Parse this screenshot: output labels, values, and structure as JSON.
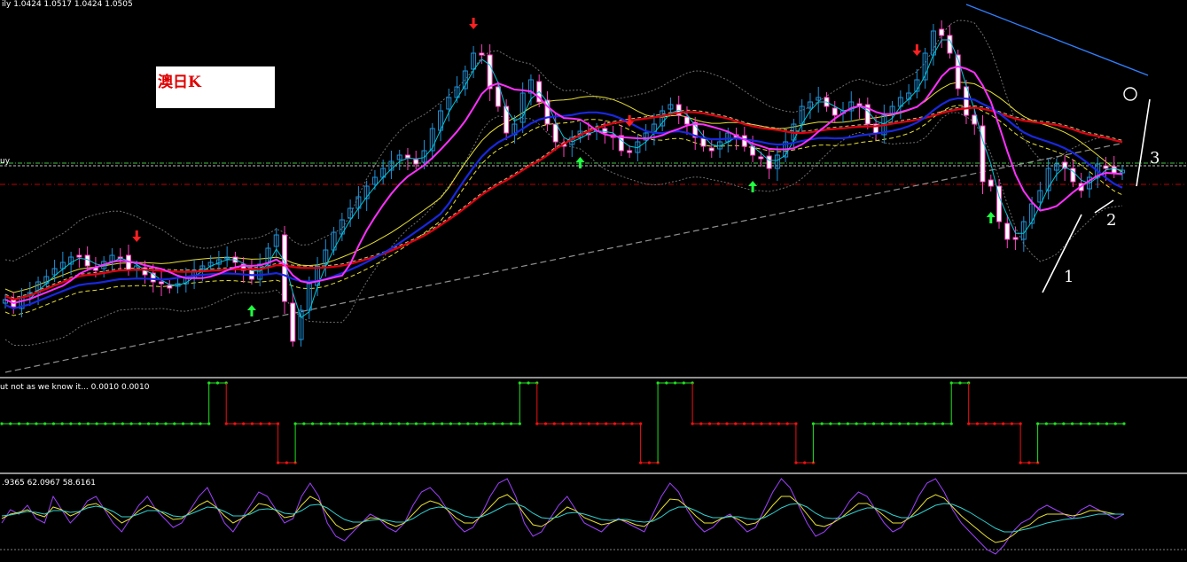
{
  "header": {
    "main_ohlc": "ily  1.0424 1.0517 1.0424 1.0505",
    "left_cut_label": "uy",
    "indicator1": "ut not as we know it...  0.0010 0.0010",
    "indicator2": ".9365 62.0967 58.6161"
  },
  "annotation": {
    "title": "澳日K",
    "wave_labels": [
      "1",
      "2",
      "3"
    ]
  },
  "colors": {
    "up_candle": "#1e90d8",
    "down_candle": "#ffffff",
    "down_candle_edge": "#ff40c0",
    "ma_fast": "#00c8d8",
    "ma_magenta": "#ff30ff",
    "ma_blue": "#1828e0",
    "ma_red": "#e00010",
    "band_yellow": "#e8e030",
    "long_ma": "#909090",
    "arrow_up": "#20ff40",
    "arrow_down": "#ff2020",
    "trend_line": "#3080ff",
    "level_green": "#40c040",
    "level_red": "#c00000"
  },
  "chart_data": [
    {
      "type": "candlestick",
      "title": "澳日K",
      "header": "ily  1.0424 1.0517 1.0424 1.0505",
      "close_path": [
        338,
        346,
        335,
        330,
        318,
        312,
        303,
        296,
        290,
        288,
        300,
        305,
        295,
        288,
        290,
        305,
        300,
        310,
        318,
        320,
        325,
        320,
        312,
        305,
        300,
        296,
        293,
        290,
        296,
        305,
        315,
        298,
        280,
        265,
        340,
        385,
        350,
        320,
        300,
        282,
        262,
        248,
        235,
        222,
        210,
        200,
        190,
        182,
        175,
        178,
        185,
        170,
        145,
        125,
        110,
        98,
        80,
        60,
        60,
        100,
        120,
        150,
        140,
        105,
        90,
        115,
        140,
        160,
        165,
        155,
        148,
        150,
        145,
        150,
        155,
        170,
        170,
        160,
        150,
        140,
        125,
        118,
        130,
        140,
        155,
        165,
        170,
        160,
        150,
        155,
        165,
        175,
        178,
        190,
        175,
        160,
        140,
        120,
        115,
        110,
        120,
        130,
        125,
        115,
        120,
        140,
        150,
        130,
        120,
        110,
        105,
        90,
        60,
        35,
        40,
        60,
        100,
        130,
        140,
        205,
        210,
        250,
        270,
        270,
        250,
        230,
        215,
        190,
        185,
        190,
        205,
        215,
        200,
        185,
        190,
        195,
        192
      ],
      "signal_arrows": [
        {
          "dir": "down",
          "bar": 16
        },
        {
          "dir": "up",
          "bar": 30
        },
        {
          "dir": "down",
          "bar": 57
        },
        {
          "dir": "up",
          "bar": 70
        },
        {
          "dir": "down",
          "bar": 76
        },
        {
          "dir": "up",
          "bar": 91
        },
        {
          "dir": "down",
          "bar": 111
        },
        {
          "dir": "up",
          "bar": 120
        }
      ]
    },
    {
      "type": "line",
      "header": "ut not as we know it...  0.0010 0.0010",
      "segments": [
        {
          "color": "green",
          "level": "mid",
          "from": 0,
          "to": 24
        },
        {
          "color": "green",
          "level": "peak",
          "from": 24,
          "to": 26
        },
        {
          "color": "red",
          "level": "mid",
          "from": 26,
          "to": 32
        },
        {
          "color": "red",
          "level": "trough",
          "from": 32,
          "to": 34
        },
        {
          "color": "green",
          "level": "mid",
          "from": 34,
          "to": 60
        },
        {
          "color": "green",
          "level": "peak",
          "from": 60,
          "to": 62
        },
        {
          "color": "red",
          "level": "mid",
          "from": 62,
          "to": 74
        },
        {
          "color": "red",
          "level": "trough",
          "from": 74,
          "to": 76
        },
        {
          "color": "green",
          "level": "peak",
          "from": 76,
          "to": 80
        },
        {
          "color": "red",
          "level": "mid",
          "from": 80,
          "to": 92
        },
        {
          "color": "red",
          "level": "trough",
          "from": 92,
          "to": 94
        },
        {
          "color": "green",
          "level": "mid",
          "from": 94,
          "to": 110
        },
        {
          "color": "green",
          "level": "peak",
          "from": 110,
          "to": 112
        },
        {
          "color": "red",
          "level": "mid",
          "from": 112,
          "to": 118
        },
        {
          "color": "red",
          "level": "trough",
          "from": 118,
          "to": 120
        },
        {
          "color": "green",
          "level": "mid",
          "from": 120,
          "to": 130
        }
      ]
    },
    {
      "type": "line",
      "header": ".9365 62.0967 58.6161",
      "series": [
        {
          "color": "#a040ff",
          "values": [
            590,
            575,
            580,
            570,
            585,
            590,
            560,
            575,
            590,
            580,
            565,
            560,
            575,
            590,
            600,
            585,
            570,
            560,
            575,
            585,
            595,
            590,
            575,
            560,
            550,
            570,
            590,
            600,
            585,
            570,
            555,
            560,
            575,
            590,
            585,
            560,
            545,
            560,
            590,
            605,
            610,
            600,
            590,
            580,
            585,
            595,
            600,
            590,
            570,
            555,
            550,
            560,
            575,
            590,
            600,
            595,
            580,
            560,
            545,
            540,
            560,
            590,
            605,
            600,
            585,
            570,
            560,
            575,
            590,
            595,
            600,
            590,
            585,
            590,
            595,
            600,
            580,
            560,
            545,
            555,
            575,
            590,
            600,
            595,
            585,
            580,
            590,
            600,
            595,
            575,
            555,
            540,
            550,
            570,
            590,
            605,
            600,
            590,
            580,
            565,
            555,
            560,
            575,
            590,
            600,
            595,
            580,
            560,
            545,
            540,
            555,
            575,
            590,
            600,
            610,
            620,
            625,
            615,
            600,
            590,
            585,
            575,
            570,
            575,
            580,
            585,
            575,
            570,
            575,
            580,
            585,
            580
          ]
        },
        {
          "color": "#e8e030",
          "values": [
            585,
            580,
            578,
            575,
            580,
            583,
            572,
            575,
            582,
            578,
            570,
            568,
            574,
            582,
            590,
            585,
            576,
            570,
            574,
            580,
            586,
            585,
            578,
            570,
            565,
            572,
            582,
            590,
            585,
            578,
            568,
            570,
            576,
            584,
            582,
            570,
            560,
            565,
            580,
            592,
            598,
            596,
            590,
            584,
            585,
            590,
            594,
            590,
            580,
            570,
            565,
            568,
            575,
            584,
            590,
            590,
            582,
            572,
            562,
            558,
            566,
            580,
            592,
            594,
            588,
            580,
            572,
            576,
            584,
            588,
            592,
            590,
            586,
            588,
            592,
            594,
            586,
            574,
            563,
            564,
            572,
            582,
            590,
            590,
            585,
            582,
            586,
            592,
            590,
            582,
            570,
            560,
            560,
            568,
            580,
            592,
            594,
            590,
            584,
            576,
            568,
            568,
            574,
            582,
            590,
            590,
            584,
            574,
            563,
            558,
            562,
            572,
            582,
            590,
            598,
            606,
            612,
            610,
            604,
            596,
            592,
            584,
            580,
            580,
            580,
            582,
            580,
            576,
            576,
            578,
            580,
            580
          ]
        },
        {
          "color": "#30d0d0",
          "values": [
            582,
            581,
            579,
            577,
            578,
            580,
            576,
            576,
            578,
            577,
            573,
            571,
            573,
            577,
            583,
            583,
            580,
            576,
            576,
            578,
            582,
            583,
            580,
            576,
            572,
            573,
            577,
            582,
            582,
            580,
            575,
            574,
            575,
            579,
            580,
            576,
            570,
            569,
            573,
            580,
            586,
            589,
            589,
            587,
            586,
            587,
            589,
            589,
            585,
            579,
            574,
            572,
            573,
            577,
            582,
            584,
            583,
            579,
            574,
            569,
            568,
            572,
            579,
            584,
            585,
            583,
            579,
            578,
            580,
            583,
            586,
            587,
            586,
            586,
            588,
            589,
            588,
            583,
            576,
            572,
            572,
            576,
            581,
            584,
            584,
            583,
            583,
            585,
            586,
            584,
            579,
            573,
            569,
            568,
            572,
            579,
            584,
            585,
            584,
            580,
            576,
            573,
            573,
            576,
            581,
            584,
            584,
            580,
            575,
            570,
            568,
            569,
            573,
            578,
            584,
            590,
            596,
            600,
            600,
            598,
            596,
            593,
            590,
            588,
            586,
            585,
            584,
            582,
            580,
            580,
            580,
            580
          ]
        }
      ]
    }
  ]
}
